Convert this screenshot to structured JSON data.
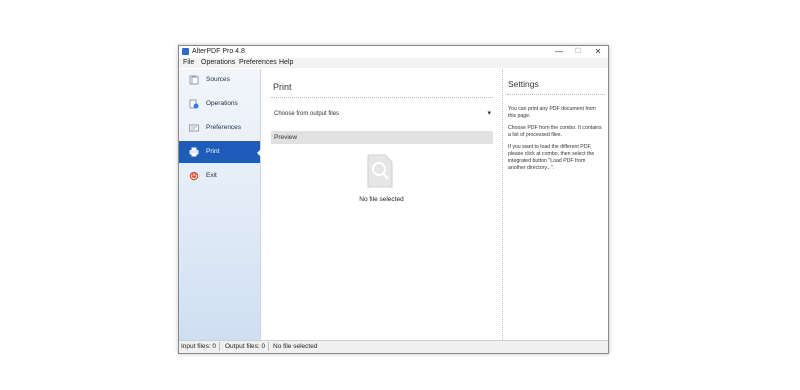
{
  "window": {
    "title": "AlterPDF Pro 4.8",
    "controls": {
      "minimize": "—",
      "maximize": "☐",
      "close": "✕"
    }
  },
  "menu": [
    "File",
    "Operations",
    "Preferences",
    "Help"
  ],
  "sidebar": {
    "items": [
      {
        "label": "Sources",
        "icon": "sources-icon"
      },
      {
        "label": "Operations",
        "icon": "operations-icon"
      },
      {
        "label": "Preferences",
        "icon": "preferences-icon"
      },
      {
        "label": "Print",
        "icon": "print-icon",
        "active": true
      },
      {
        "label": "Exit",
        "icon": "exit-icon"
      }
    ],
    "active_color": "#1f5bb8"
  },
  "main": {
    "title": "Print",
    "combo_text": "Choose from output files",
    "preview_label": "Preview",
    "no_file_text": "No file selected"
  },
  "settings": {
    "title": "Settings",
    "paragraphs": [
      "You can print any PDF document from this page.",
      "Choose PDF from the combo. It contains a list of processed files.",
      "If you want to load the different PDF, please click at combo, then select the integrated button \"Load PDF from another directory...\"."
    ]
  },
  "status": {
    "input_files": "Input files: 0",
    "output_files": "Output files: 0",
    "selection": "No file selected"
  }
}
